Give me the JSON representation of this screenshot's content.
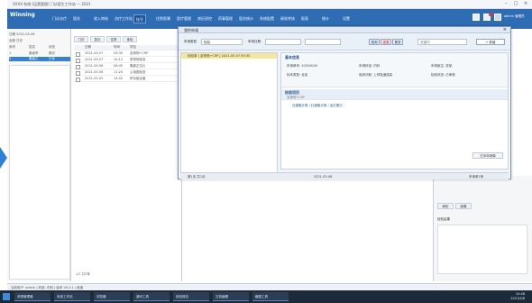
{
  "window": {
    "title": "XXXX-系统 [运营管理] 门诊医生工作站 — 2021"
  },
  "menu": {
    "logo": "Winning",
    "items": [
      "门诊诊疗",
      "医技",
      "收入审核",
      "治疗工作站",
      "挂号",
      "住院医嘱",
      "医疗管理",
      "病历质控",
      "药事管理",
      "医技统计",
      "系统配置",
      "绩效考核",
      "报表",
      "统计",
      "设置"
    ],
    "active_index": 4,
    "user": "admin 管理员"
  },
  "left_panel": {
    "date_label": "日期 2021-05-08",
    "filter_label": "全部 已诊",
    "columns": [
      "序号",
      "姓名",
      "状态"
    ],
    "rows": [
      {
        "a": "1",
        "b": "患者甲",
        "c": "候诊"
      },
      {
        "a": "2",
        "b": "患者乙",
        "c": "已诊"
      }
    ],
    "selected": 1
  },
  "mid_panel": {
    "tabs": [
      "门诊",
      "急诊",
      "住院",
      "体检"
    ],
    "columns": [
      "日期",
      "时间",
      "项目"
    ],
    "rows": [
      [
        "2021-05-07",
        "09:30",
        "血常规+CRP"
      ],
      [
        "2021-05-07",
        "10:12",
        "尿常规检查"
      ],
      [
        "2021-05-06",
        "08:45",
        "胸部正位片"
      ],
      [
        "2021-05-06",
        "11:20",
        "心电图检查"
      ],
      [
        "2021-05-05",
        "14:02",
        "肝功能全套"
      ]
    ],
    "footer": "1/1 共5条"
  },
  "modal": {
    "title": "我的申请",
    "filter": {
      "type_label": "申请类型",
      "type_value": "检验",
      "date_label": "申请日期",
      "date_from": "",
      "date_to": "",
      "keyword_placeholder": "关键词",
      "btn_query": "查询",
      "btn_reset": "重置",
      "btn_more": "更多",
      "btn_new": "+ 新增"
    },
    "list_item": "检验单 | 血常规+CRP | 2021-05-07 09:30",
    "pager": "第1页 共1页",
    "detail": {
      "section1_title": "基本信息",
      "fields": [
        {
          "k": "申请单号",
          "v": "10020045"
        },
        {
          "k": "申请科室",
          "v": "内科"
        },
        {
          "k": "申请医生",
          "v": "张某"
        },
        {
          "k": "标本类型",
          "v": "全血"
        },
        {
          "k": "临床诊断",
          "v": "上呼吸道感染"
        },
        {
          "k": "检验状态",
          "v": "已审核"
        }
      ],
      "section2_title": "检验项目",
      "section2_sub": "血常规+CRP",
      "item_text": "白细胞计数 / 红细胞计数 / 血红蛋白",
      "print_btn": "打印申请单",
      "footer_date": "2021-05-08",
      "footer_right": "申请单1条"
    }
  },
  "right_bottom": {
    "tab1": "病历",
    "tab2": "医嘱",
    "field": "检验结果"
  },
  "statusbar": "当前用户: admin  |  科室: 内科  |  版本 V5.0.1  |  就绪",
  "taskbar": {
    "tasks": [
      "资源管理器",
      "系统工作站",
      "浏览器",
      "通讯工具",
      "检验报告",
      "文档编辑",
      "截图工具"
    ],
    "clock_time": "10:48",
    "clock_date": "2021/5/8"
  }
}
